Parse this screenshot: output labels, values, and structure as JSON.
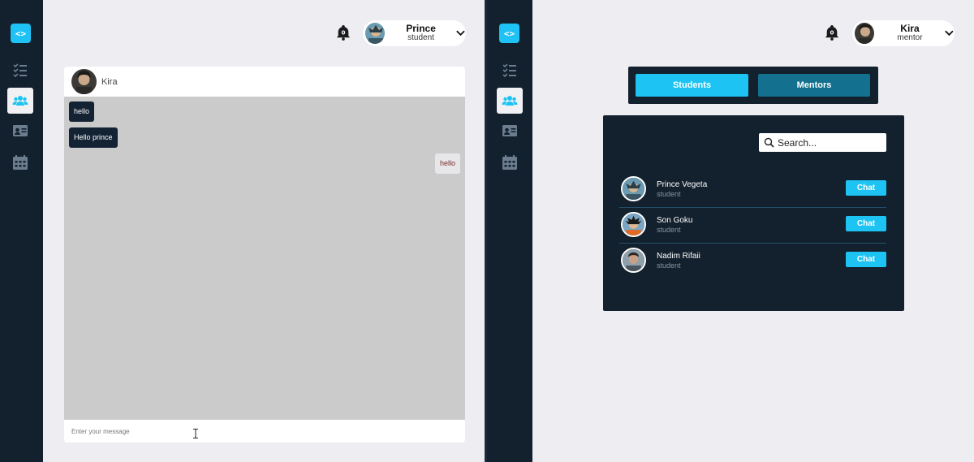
{
  "left": {
    "logo_glyph": "<>",
    "user": {
      "name": "Prince",
      "role": "student"
    },
    "chat": {
      "contact_name": "Kira",
      "messages": [
        {
          "text": "hello",
          "direction": "in"
        },
        {
          "text": "Hello prince",
          "direction": "in"
        },
        {
          "text": "hello",
          "direction": "out"
        }
      ],
      "input_placeholder": "Enter your message"
    }
  },
  "right": {
    "logo_glyph": "<>",
    "user": {
      "name": "Kira",
      "role": "mentor"
    },
    "tabs": {
      "students": "Students",
      "mentors": "Mentors"
    },
    "search_placeholder": "Search...",
    "people": [
      {
        "name": "Prince Vegeta",
        "role": "student",
        "action": "Chat"
      },
      {
        "name": "Son Goku",
        "role": "student",
        "action": "Chat"
      },
      {
        "name": "Nadim Rifaii",
        "role": "student",
        "action": "Chat"
      }
    ]
  },
  "colors": {
    "sidebar": "#13202d",
    "accent": "#1cc3f3",
    "tab_inactive": "#13708f",
    "chat_body": "#cbcbcb"
  }
}
